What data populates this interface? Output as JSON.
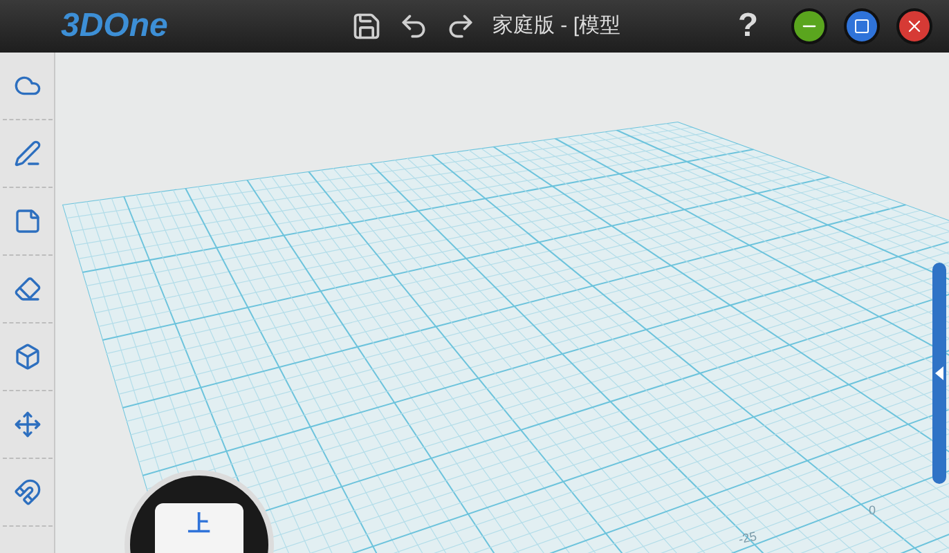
{
  "app": {
    "logo": "3DOne",
    "title": "家庭版 - [模型",
    "help": "?"
  },
  "view_cube": {
    "top_label": "上"
  },
  "grid_labels": [
    "-25",
    "0"
  ]
}
